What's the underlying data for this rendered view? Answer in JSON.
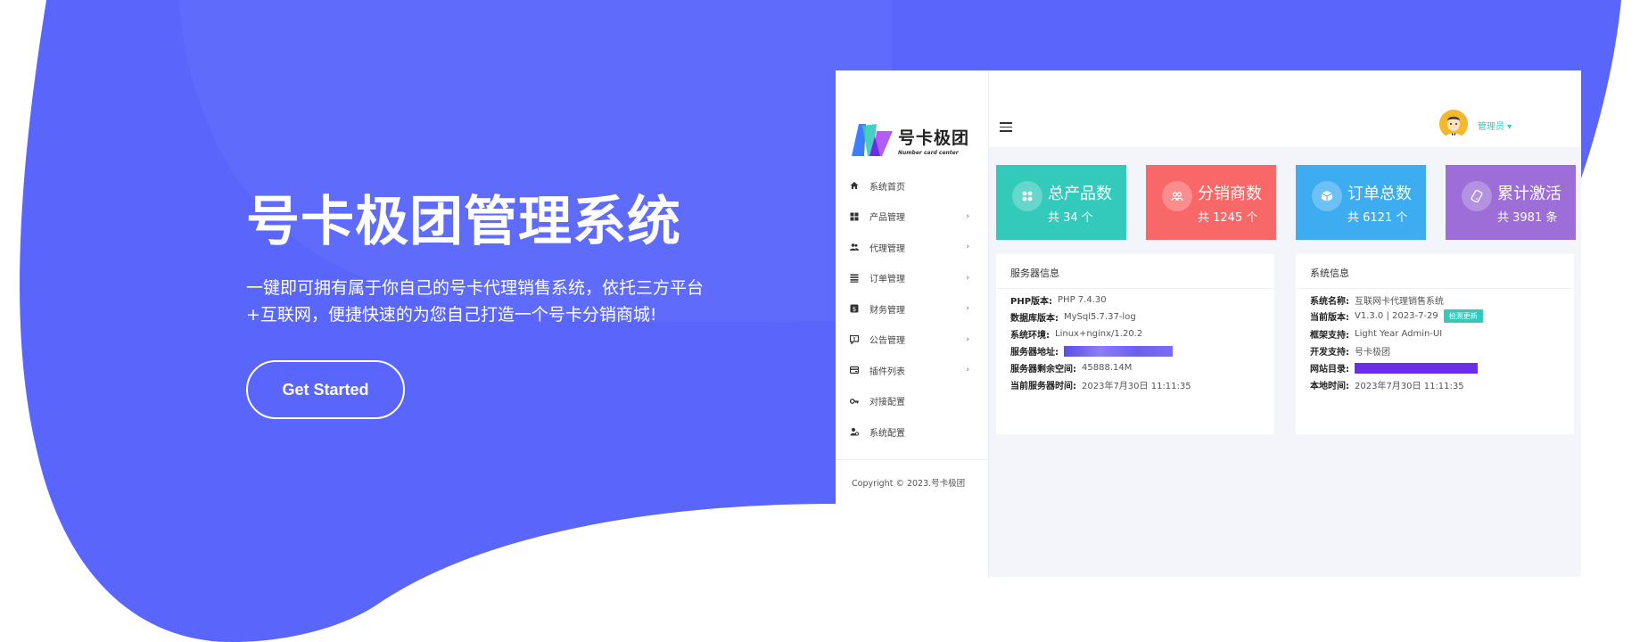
{
  "hero": {
    "title": "号卡极团管理系统",
    "subtitle": "一键即可拥有属于你自己的号卡代理销售系统，依托三方平台+互联网，便捷快速的为您自己打造一个号卡分销商城!",
    "cta": "Get Started"
  },
  "colors": {
    "hero_bg": "#5a66fb",
    "accent": "#33cabb",
    "stat_product": "#33cabb",
    "stat_distributor": "#f96868",
    "stat_order": "#3eacf0",
    "stat_activation": "#9d6dd8"
  },
  "app": {
    "logo_text": "号卡极团",
    "logo_sub": "Number card center",
    "menu": [
      {
        "label": "系统首页",
        "icon": "home-icon",
        "has_children": false
      },
      {
        "label": "产品管理",
        "icon": "grid-icon",
        "has_children": true
      },
      {
        "label": "代理管理",
        "icon": "users-icon",
        "has_children": true
      },
      {
        "label": "订单管理",
        "icon": "list-icon",
        "has_children": true
      },
      {
        "label": "财务管理",
        "icon": "dollar-icon",
        "has_children": true
      },
      {
        "label": "公告管理",
        "icon": "announce-icon",
        "has_children": true
      },
      {
        "label": "插件列表",
        "icon": "plugin-icon",
        "has_children": true
      },
      {
        "label": "对接配置",
        "icon": "key-icon",
        "has_children": false
      },
      {
        "label": "系统配置",
        "icon": "settings-icon",
        "has_children": false
      }
    ],
    "copyright": "Copyright © 2023.号卡极团",
    "chevron": "›",
    "user": "管理员 ▾",
    "stats": [
      {
        "title": "总产品数",
        "count": "共 34 个",
        "icon": "product-icon"
      },
      {
        "title": "分销商数",
        "count": "共 1245 个",
        "icon": "distributor-icon"
      },
      {
        "title": "订单总数",
        "count": "共 6121 个",
        "icon": "order-icon"
      },
      {
        "title": "累计激活",
        "count": "共 3981 条",
        "icon": "activation-icon"
      }
    ],
    "server_panel": {
      "title": "服务器信息",
      "rows": [
        {
          "key": "PHP版本:",
          "value": "PHP 7.4.30"
        },
        {
          "key": "数据库版本:",
          "value": "MySql5.7.37-log"
        },
        {
          "key": "系统环境:",
          "value": "Linux+nginx/1.20.2"
        },
        {
          "key": "服务器地址:",
          "value": ""
        },
        {
          "key": "服务器剩余空间:",
          "value": "45888.14M"
        },
        {
          "key": "当前服务器时间:",
          "value": "2023年7月30日 11:11:35"
        }
      ]
    },
    "system_panel": {
      "title": "系统信息",
      "rows": [
        {
          "key": "系统名称:",
          "value": "互联网卡代理销售系统"
        },
        {
          "key": "当前版本:",
          "value": "V1.3.0 | 2023-7-29"
        },
        {
          "key": "框架支持:",
          "value": "Light Year Admin-UI"
        },
        {
          "key": "开发支持:",
          "value": "号卡极团"
        },
        {
          "key": "网站目录:",
          "value": ""
        },
        {
          "key": "本地时间:",
          "value": "2023年7月30日 11:11:35"
        }
      ],
      "update_badge": "检测更新"
    }
  }
}
